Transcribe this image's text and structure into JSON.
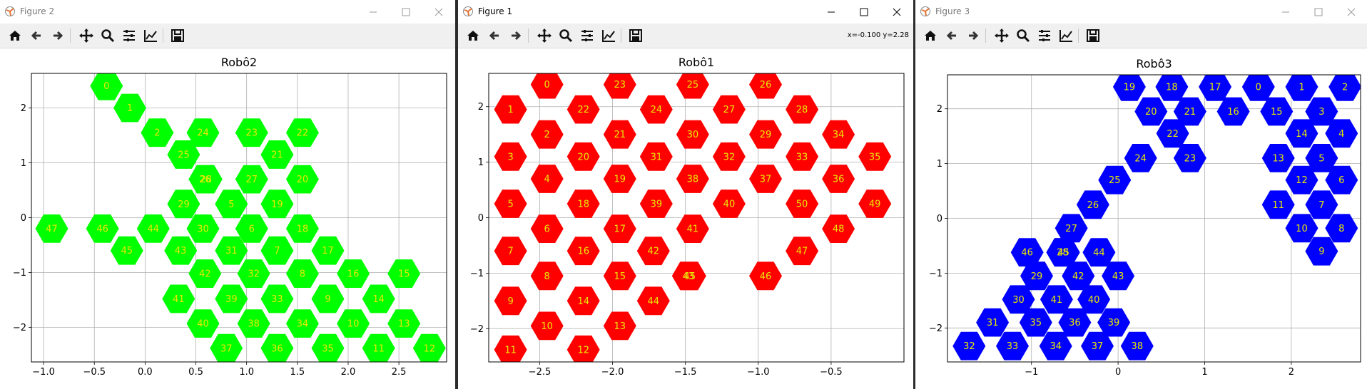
{
  "windows": [
    {
      "key": "fig2",
      "title": "Figure 2",
      "state": "inactive",
      "coord_readout": "",
      "chart": {
        "title": "Robô2",
        "face_color": "#00ff00",
        "label_color": "#e8e800",
        "xlim": [
          -1.12,
          2.97
        ],
        "ylim": [
          -2.63,
          2.63
        ],
        "xticks": [
          -1.0,
          -0.5,
          0.0,
          0.5,
          1.0,
          1.5,
          2.0,
          2.5
        ],
        "xtick_labels": [
          "−1.0",
          "−0.5",
          "0.0",
          "0.5",
          "1.0",
          "1.5",
          "2.0",
          "2.5"
        ],
        "yticks": [
          -2,
          -1,
          0,
          1,
          2
        ],
        "ytick_labels": [
          "−2",
          "−1",
          "0",
          "1",
          "2"
        ]
      }
    },
    {
      "key": "fig1",
      "title": "Figure 1",
      "state": "active",
      "coord_readout": "x=-0.100 y=2.28",
      "chart": {
        "title": "Robô1",
        "face_color": "#ff0000",
        "label_color": "#e8e800",
        "xlim": [
          -2.85,
          0.0
        ],
        "ylim": [
          -2.6,
          2.6
        ],
        "xticks": [
          -2.5,
          -2.0,
          -1.5,
          -1.0,
          -0.5
        ],
        "xtick_labels": [
          "−2.5",
          "−2.0",
          "−1.5",
          "−1.0",
          "−0.5"
        ],
        "yticks": [
          -2,
          -1,
          0,
          1,
          2
        ],
        "ytick_labels": [
          "−2",
          "−1",
          "0",
          "1",
          "2"
        ]
      }
    },
    {
      "key": "fig3",
      "title": "Figure 3",
      "state": "inactive",
      "coord_readout": "",
      "chart": {
        "title": "Robô3",
        "face_color": "#0000ff",
        "label_color": "#e8e800",
        "xlim": [
          -1.97,
          2.8
        ],
        "ylim": [
          -2.62,
          2.62
        ],
        "xticks": [
          -1,
          0,
          1,
          2
        ],
        "xtick_labels": [
          "−1",
          "0",
          "1",
          "2"
        ],
        "yticks": [
          -2,
          -1,
          0,
          1,
          2
        ],
        "ytick_labels": [
          "−2",
          "−1",
          "0",
          "1",
          "2"
        ]
      }
    }
  ],
  "toolbar_icons": [
    "home-icon",
    "back-icon",
    "forward-icon",
    "pan-icon",
    "zoom-icon",
    "configure-subplots-icon",
    "edit-axes-icon",
    "save-icon"
  ],
  "chart_data": [
    {
      "type": "scatter",
      "title": "Robô2",
      "marker": "hexagon",
      "xlim": [
        -1.12,
        2.97
      ],
      "ylim": [
        -2.63,
        2.63
      ],
      "grid": true,
      "points": [
        {
          "label": "0",
          "x": -0.38,
          "y": 2.4
        },
        {
          "label": "1",
          "x": -0.15,
          "y": 2.0
        },
        {
          "label": "2",
          "x": 0.12,
          "y": 1.55
        },
        {
          "label": "24",
          "x": 0.57,
          "y": 1.55
        },
        {
          "label": "23",
          "x": 1.05,
          "y": 1.55
        },
        {
          "label": "22",
          "x": 1.55,
          "y": 1.55
        },
        {
          "label": "25",
          "x": 0.38,
          "y": 1.15
        },
        {
          "label": "21",
          "x": 1.3,
          "y": 1.15
        },
        {
          "label": "26",
          "x": 0.59,
          "y": 0.7
        },
        {
          "label": "28",
          "x": 0.6,
          "y": 0.7
        },
        {
          "label": "27",
          "x": 1.05,
          "y": 0.7
        },
        {
          "label": "20",
          "x": 1.55,
          "y": 0.7
        },
        {
          "label": "29",
          "x": 0.38,
          "y": 0.25
        },
        {
          "label": "5",
          "x": 0.85,
          "y": 0.25
        },
        {
          "label": "19",
          "x": 1.3,
          "y": 0.25
        },
        {
          "label": "47",
          "x": -0.92,
          "y": -0.2
        },
        {
          "label": "46",
          "x": -0.42,
          "y": -0.2
        },
        {
          "label": "44",
          "x": 0.08,
          "y": -0.2
        },
        {
          "label": "30",
          "x": 0.57,
          "y": -0.2
        },
        {
          "label": "6",
          "x": 1.05,
          "y": -0.2
        },
        {
          "label": "18",
          "x": 1.55,
          "y": -0.2
        },
        {
          "label": "45",
          "x": -0.18,
          "y": -0.6
        },
        {
          "label": "43",
          "x": 0.35,
          "y": -0.6
        },
        {
          "label": "31",
          "x": 0.85,
          "y": -0.6
        },
        {
          "label": "7",
          "x": 1.3,
          "y": -0.6
        },
        {
          "label": "17",
          "x": 1.8,
          "y": -0.6
        },
        {
          "label": "42",
          "x": 0.59,
          "y": -1.02
        },
        {
          "label": "32",
          "x": 1.07,
          "y": -1.02
        },
        {
          "label": "8",
          "x": 1.55,
          "y": -1.02
        },
        {
          "label": "16",
          "x": 2.05,
          "y": -1.02
        },
        {
          "label": "15",
          "x": 2.55,
          "y": -1.02
        },
        {
          "label": "41",
          "x": 0.33,
          "y": -1.48
        },
        {
          "label": "39",
          "x": 0.85,
          "y": -1.48
        },
        {
          "label": "33",
          "x": 1.3,
          "y": -1.48
        },
        {
          "label": "9",
          "x": 1.8,
          "y": -1.48
        },
        {
          "label": "14",
          "x": 2.3,
          "y": -1.48
        },
        {
          "label": "40",
          "x": 0.57,
          "y": -1.93
        },
        {
          "label": "38",
          "x": 1.07,
          "y": -1.93
        },
        {
          "label": "34",
          "x": 1.55,
          "y": -1.93
        },
        {
          "label": "10",
          "x": 2.05,
          "y": -1.93
        },
        {
          "label": "13",
          "x": 2.55,
          "y": -1.93
        },
        {
          "label": "37",
          "x": 0.8,
          "y": -2.38
        },
        {
          "label": "36",
          "x": 1.3,
          "y": -2.38
        },
        {
          "label": "35",
          "x": 1.8,
          "y": -2.38
        },
        {
          "label": "11",
          "x": 2.3,
          "y": -2.38
        },
        {
          "label": "12",
          "x": 2.8,
          "y": -2.38
        }
      ]
    },
    {
      "type": "scatter",
      "title": "Robô1",
      "marker": "hexagon",
      "xlim": [
        -2.85,
        0.0
      ],
      "ylim": [
        -2.6,
        2.6
      ],
      "grid": true,
      "points": [
        {
          "label": "0",
          "x": -2.45,
          "y": 2.4
        },
        {
          "label": "23",
          "x": -1.95,
          "y": 2.4
        },
        {
          "label": "25",
          "x": -1.45,
          "y": 2.4
        },
        {
          "label": "26",
          "x": -0.95,
          "y": 2.4
        },
        {
          "label": "1",
          "x": -2.7,
          "y": 1.95
        },
        {
          "label": "22",
          "x": -2.2,
          "y": 1.95
        },
        {
          "label": "24",
          "x": -1.7,
          "y": 1.95
        },
        {
          "label": "27",
          "x": -1.2,
          "y": 1.95
        },
        {
          "label": "28",
          "x": -0.7,
          "y": 1.95
        },
        {
          "label": "2",
          "x": -2.45,
          "y": 1.5
        },
        {
          "label": "21",
          "x": -1.95,
          "y": 1.5
        },
        {
          "label": "30",
          "x": -1.45,
          "y": 1.5
        },
        {
          "label": "29",
          "x": -0.95,
          "y": 1.5
        },
        {
          "label": "34",
          "x": -0.45,
          "y": 1.5
        },
        {
          "label": "3",
          "x": -2.7,
          "y": 1.1
        },
        {
          "label": "20",
          "x": -2.2,
          "y": 1.1
        },
        {
          "label": "31",
          "x": -1.7,
          "y": 1.1
        },
        {
          "label": "32",
          "x": -1.2,
          "y": 1.1
        },
        {
          "label": "33",
          "x": -0.7,
          "y": 1.1
        },
        {
          "label": "35",
          "x": -0.2,
          "y": 1.1
        },
        {
          "label": "4",
          "x": -2.45,
          "y": 0.7
        },
        {
          "label": "19",
          "x": -1.95,
          "y": 0.7
        },
        {
          "label": "38",
          "x": -1.45,
          "y": 0.7
        },
        {
          "label": "37",
          "x": -0.95,
          "y": 0.7
        },
        {
          "label": "36",
          "x": -0.45,
          "y": 0.7
        },
        {
          "label": "5",
          "x": -2.7,
          "y": 0.25
        },
        {
          "label": "18",
          "x": -2.2,
          "y": 0.25
        },
        {
          "label": "39",
          "x": -1.7,
          "y": 0.25
        },
        {
          "label": "40",
          "x": -1.2,
          "y": 0.25
        },
        {
          "label": "50",
          "x": -0.7,
          "y": 0.25
        },
        {
          "label": "49",
          "x": -0.2,
          "y": 0.25
        },
        {
          "label": "6",
          "x": -2.45,
          "y": -0.2
        },
        {
          "label": "17",
          "x": -1.95,
          "y": -0.2
        },
        {
          "label": "41",
          "x": -1.45,
          "y": -0.2
        },
        {
          "label": "48",
          "x": -0.45,
          "y": -0.2
        },
        {
          "label": "7",
          "x": -2.7,
          "y": -0.6
        },
        {
          "label": "16",
          "x": -2.2,
          "y": -0.6
        },
        {
          "label": "42",
          "x": -1.72,
          "y": -0.6
        },
        {
          "label": "47",
          "x": -0.7,
          "y": -0.6
        },
        {
          "label": "8",
          "x": -2.45,
          "y": -1.05
        },
        {
          "label": "15",
          "x": -1.95,
          "y": -1.05
        },
        {
          "label": "43",
          "x": -1.48,
          "y": -1.05
        },
        {
          "label": "45",
          "x": -1.47,
          "y": -1.05
        },
        {
          "label": "46",
          "x": -0.95,
          "y": -1.05
        },
        {
          "label": "9",
          "x": -2.7,
          "y": -1.5
        },
        {
          "label": "14",
          "x": -2.2,
          "y": -1.5
        },
        {
          "label": "44",
          "x": -1.72,
          "y": -1.5
        },
        {
          "label": "10",
          "x": -2.45,
          "y": -1.95
        },
        {
          "label": "13",
          "x": -1.95,
          "y": -1.95
        },
        {
          "label": "11",
          "x": -2.7,
          "y": -2.38
        },
        {
          "label": "12",
          "x": -2.2,
          "y": -2.38
        }
      ]
    },
    {
      "type": "scatter",
      "title": "Robô3",
      "marker": "hexagon",
      "xlim": [
        -1.97,
        2.8
      ],
      "ylim": [
        -2.62,
        2.62
      ],
      "grid": true,
      "points": [
        {
          "label": "19",
          "x": 0.13,
          "y": 2.4
        },
        {
          "label": "18",
          "x": 0.62,
          "y": 2.4
        },
        {
          "label": "17",
          "x": 1.12,
          "y": 2.4
        },
        {
          "label": "0",
          "x": 1.62,
          "y": 2.4
        },
        {
          "label": "1",
          "x": 2.12,
          "y": 2.4
        },
        {
          "label": "2",
          "x": 2.62,
          "y": 2.4
        },
        {
          "label": "20",
          "x": 0.38,
          "y": 1.95
        },
        {
          "label": "21",
          "x": 0.83,
          "y": 1.95
        },
        {
          "label": "16",
          "x": 1.33,
          "y": 1.95
        },
        {
          "label": "15",
          "x": 1.83,
          "y": 1.95
        },
        {
          "label": "3",
          "x": 2.35,
          "y": 1.95
        },
        {
          "label": "22",
          "x": 0.63,
          "y": 1.55
        },
        {
          "label": "14",
          "x": 2.12,
          "y": 1.55
        },
        {
          "label": "4",
          "x": 2.58,
          "y": 1.55
        },
        {
          "label": "24",
          "x": 0.26,
          "y": 1.1
        },
        {
          "label": "23",
          "x": 0.83,
          "y": 1.1
        },
        {
          "label": "13",
          "x": 1.85,
          "y": 1.1
        },
        {
          "label": "5",
          "x": 2.35,
          "y": 1.1
        },
        {
          "label": "25",
          "x": -0.04,
          "y": 0.7
        },
        {
          "label": "12",
          "x": 2.12,
          "y": 0.7
        },
        {
          "label": "6",
          "x": 2.58,
          "y": 0.7
        },
        {
          "label": "26",
          "x": -0.29,
          "y": 0.25
        },
        {
          "label": "11",
          "x": 1.85,
          "y": 0.25
        },
        {
          "label": "7",
          "x": 2.35,
          "y": 0.25
        },
        {
          "label": "27",
          "x": -0.54,
          "y": -0.18
        },
        {
          "label": "10",
          "x": 2.12,
          "y": -0.18
        },
        {
          "label": "8",
          "x": 2.58,
          "y": -0.18
        },
        {
          "label": "9",
          "x": 2.35,
          "y": -0.6
        },
        {
          "label": "46",
          "x": -1.05,
          "y": -0.62
        },
        {
          "label": "28",
          "x": -0.64,
          "y": -0.62
        },
        {
          "label": "45",
          "x": -0.63,
          "y": -0.62
        },
        {
          "label": "44",
          "x": -0.22,
          "y": -0.62
        },
        {
          "label": "29",
          "x": -0.94,
          "y": -1.05
        },
        {
          "label": "42",
          "x": -0.46,
          "y": -1.05
        },
        {
          "label": "43",
          "x": 0.0,
          "y": -1.05
        },
        {
          "label": "30",
          "x": -1.15,
          "y": -1.48
        },
        {
          "label": "41",
          "x": -0.71,
          "y": -1.48
        },
        {
          "label": "40",
          "x": -0.28,
          "y": -1.48
        },
        {
          "label": "31",
          "x": -1.45,
          "y": -1.9
        },
        {
          "label": "35",
          "x": -0.95,
          "y": -1.9
        },
        {
          "label": "36",
          "x": -0.5,
          "y": -1.9
        },
        {
          "label": "39",
          "x": -0.05,
          "y": -1.9
        },
        {
          "label": "32",
          "x": -1.72,
          "y": -2.33
        },
        {
          "label": "33",
          "x": -1.22,
          "y": -2.33
        },
        {
          "label": "34",
          "x": -0.72,
          "y": -2.33
        },
        {
          "label": "37",
          "x": -0.24,
          "y": -2.33
        },
        {
          "label": "38",
          "x": 0.22,
          "y": -2.33
        }
      ]
    }
  ]
}
